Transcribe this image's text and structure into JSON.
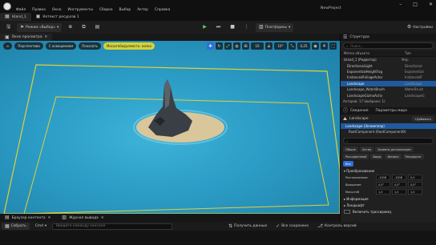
{
  "app": {
    "title": "NewProject"
  },
  "menu": [
    "Файл",
    "Правка",
    "Окно",
    "Инструменты",
    "Сборка",
    "Выбор",
    "Актер",
    "Справка"
  ],
  "doc_tabs": [
    {
      "label": "Island_1",
      "active": true
    },
    {
      "label": "Котекст ресурсов 1"
    }
  ],
  "toolbar": {
    "mode": "Режим «Выбор»",
    "platform": "Платформы",
    "settings": "Настройки"
  },
  "viewport_tab": "Окно просмотра",
  "viewport": {
    "perspective": "Перспектива",
    "lit": "С освещением",
    "show": "Показать",
    "scalability": "Масштабируемость: низко",
    "grid_snap": "10",
    "rot_snap": "10°",
    "scale_snap": "0,25",
    "camera_speed": "4"
  },
  "bottom_tabs": [
    "Браузер контента",
    "Журнал вывода"
  ],
  "status": {
    "content_drawer": "Собрать",
    "cmd": "Cmd",
    "console_placeholder": "Введите команду консоли",
    "derived": "Получить данные",
    "all_saved": "Все сохранено",
    "revision": "Контроль версий"
  },
  "outliner": {
    "tab": "Структура",
    "search_placeholder": "Поиск...",
    "col_label": "Метка объекта",
    "col_type": "Тип",
    "rows": [
      {
        "name": "Island_1 (Редактор)",
        "type": "Мир",
        "indent": 0
      },
      {
        "name": "DirectionalLight",
        "type": "Directional",
        "indent": 1
      },
      {
        "name": "ExponentialHeightFog",
        "type": "Exponential",
        "indent": 1
      },
      {
        "name": "InstancedFoliageActor",
        "type": "InstancedF",
        "indent": 1
      },
      {
        "name": "Landscape",
        "type": "Landscape",
        "indent": 1,
        "selected": true
      },
      {
        "name": "Landscape_WaterBrush",
        "type": "WaterBrush",
        "indent": 1
      },
      {
        "name": "LandscapeGizmoActiv",
        "type": "LandscapeG",
        "indent": 1
      }
    ],
    "footer": "Актеров: 17 (выбрано: 1)"
  },
  "details": {
    "tab": "Сведения",
    "tab2": "Параметры мира",
    "actor_name": "Landscape",
    "add_button": "Добавить",
    "components": [
      "Landscape (Экземпляр)",
      "RootComponent (RootComponent0)"
    ],
    "filter_chips": [
      "Общие",
      "Актер",
      "Уровень детализации",
      "Расширенный",
      "Виды",
      "Физика",
      "Рендеринг",
      "Все"
    ],
    "transform_label": "Преобразование",
    "location_label": "Расположение",
    "rotation_label": "Вращение",
    "scale_label": "Масштаб",
    "location": [
      "-1008",
      "-1008",
      "0,0"
    ],
    "rotation": [
      "0,0°",
      "0,0°",
      "0,0°"
    ],
    "scale": [
      "1,0",
      "1,0",
      "1,0"
    ],
    "sec_info": "Информация",
    "sec_landscape": "Ландшафт",
    "sec_trace": "Включить трассировку"
  },
  "colors": {
    "accent": "#2f6fd6",
    "select": "#1f5a9e",
    "water": "#2b9cc5",
    "bounds": "#e1cf3a",
    "play": "#5bd35b"
  }
}
